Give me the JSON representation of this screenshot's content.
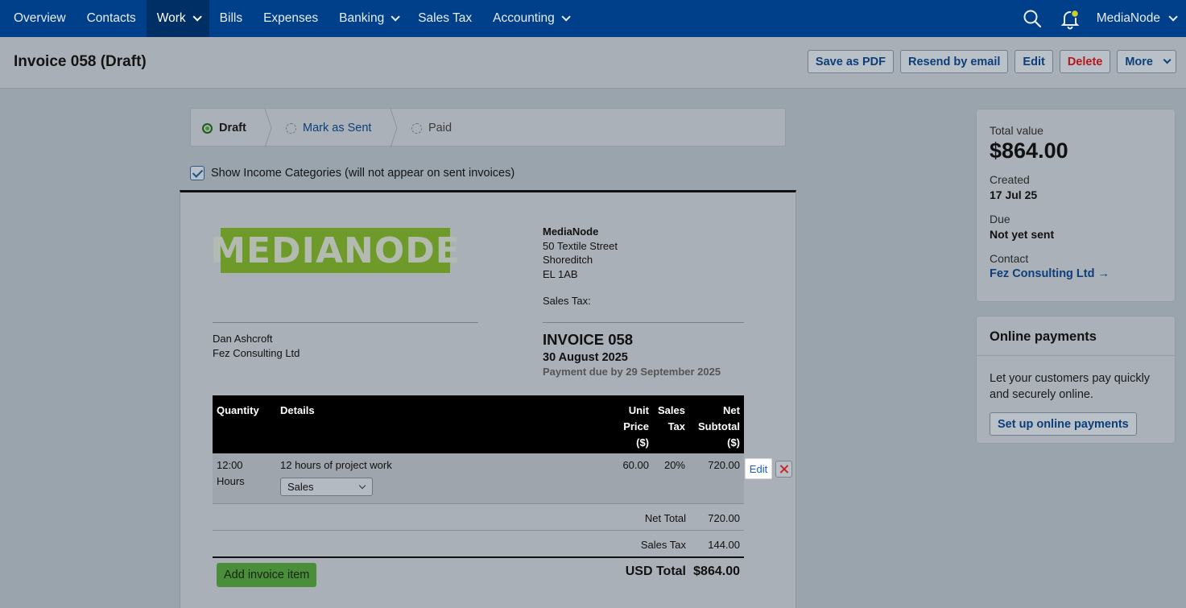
{
  "nav": {
    "items": [
      {
        "label": "Overview",
        "dropdown": false,
        "active": false
      },
      {
        "label": "Contacts",
        "dropdown": false,
        "active": false
      },
      {
        "label": "Work",
        "dropdown": true,
        "active": true
      },
      {
        "label": "Bills",
        "dropdown": false,
        "active": false
      },
      {
        "label": "Expenses",
        "dropdown": false,
        "active": false
      },
      {
        "label": "Banking",
        "dropdown": true,
        "active": false
      },
      {
        "label": "Sales Tax",
        "dropdown": false,
        "active": false
      },
      {
        "label": "Accounting",
        "dropdown": true,
        "active": false
      }
    ],
    "account": "MediaNode",
    "icons": [
      "search-icon",
      "bell-icon"
    ]
  },
  "header": {
    "title": "Invoice 058 (Draft)",
    "actions": {
      "save_pdf": "Save as PDF",
      "resend": "Resend by email",
      "edit": "Edit",
      "delete": "Delete",
      "more": "More"
    }
  },
  "steps": {
    "draft": "Draft",
    "mark_sent": "Mark as Sent",
    "paid": "Paid"
  },
  "show_categories": {
    "label": "Show Income Categories (will not appear on sent invoices)",
    "checked": true
  },
  "invoice": {
    "logo_text": "MEDIANODE",
    "company": {
      "name": "MediaNode",
      "address": [
        "50 Textile Street",
        "Shoreditch",
        "EL 1AB"
      ],
      "sales_tax": "Sales Tax:"
    },
    "client": [
      "Dan Ashcroft",
      "Fez Consulting Ltd"
    ],
    "title": "INVOICE 058",
    "date": "30 August 2025",
    "due": "Payment due by 29 September 2025",
    "columns": {
      "quantity": "Quantity",
      "details": "Details",
      "unit_price": [
        "Unit",
        "Price",
        "($)"
      ],
      "sales_tax": [
        "Sales",
        "Tax"
      ],
      "net_subtotal": [
        "Net",
        "Subtotal",
        "($)"
      ]
    },
    "items": [
      {
        "quantity": [
          "12:00",
          "Hours"
        ],
        "details": "12 hours of project work",
        "category": "Sales",
        "unit_price": "60.00",
        "sales_tax": "20%",
        "net_subtotal": "720.00",
        "edit_label": "Edit"
      }
    ],
    "net_total_label": "Net Total",
    "net_total": "720.00",
    "sales_tax_label": "Sales Tax",
    "sales_tax_total": "144.00",
    "usd_total_label": "USD Total",
    "usd_total": "$864.00",
    "add_item_label": "Add invoice item"
  },
  "summary": {
    "total_label": "Total value",
    "total": "$864.00",
    "created_label": "Created",
    "created": "17 Jul 25",
    "due_label": "Due",
    "due": "Not yet sent",
    "contact_label": "Contact",
    "contact": "Fez Consulting Ltd →"
  },
  "online_payments": {
    "title": "Online payments",
    "text": "Let your customers pay quickly and securely online.",
    "button": "Set up online payments"
  },
  "colors": {
    "nav_bg": "#00408a",
    "accent_link": "#0c3f7a",
    "danger": "#b4161b",
    "success": "#4a8e3c",
    "logo_green": "#6e9a2a"
  }
}
